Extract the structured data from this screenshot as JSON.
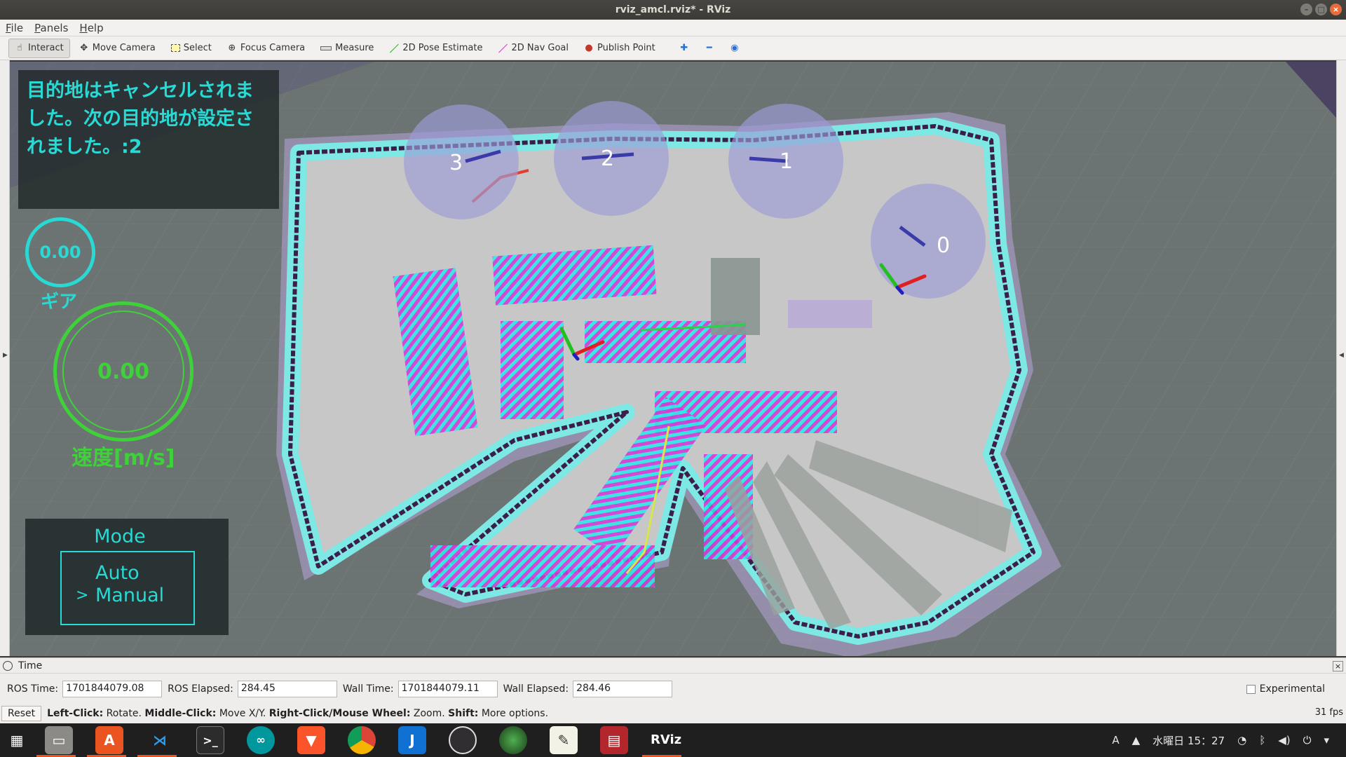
{
  "window": {
    "title": "rviz_amcl.rviz* - RViz"
  },
  "menu": {
    "items": [
      "File",
      "Panels",
      "Help"
    ]
  },
  "toolbar": {
    "tools": [
      {
        "label": "Interact",
        "icon": "hand-icon"
      },
      {
        "label": "Move Camera",
        "icon": "move-icon"
      },
      {
        "label": "Select",
        "icon": "select-box-icon"
      },
      {
        "label": "Focus Camera",
        "icon": "crosshair-icon"
      },
      {
        "label": "Measure",
        "icon": "ruler-icon"
      },
      {
        "label": "2D Pose Estimate",
        "icon": "green-arrow-icon"
      },
      {
        "label": "2D Nav Goal",
        "icon": "pink-arrow-icon"
      },
      {
        "label": "Publish Point",
        "icon": "pin-icon"
      }
    ],
    "active": "Interact"
  },
  "overlay": {
    "message": "目的地はキャンセルされました。次の目的地が設定されました。:2",
    "gear": {
      "value": "0.00",
      "label": "ギア"
    },
    "speed": {
      "value": "0.00",
      "label": "速度[m/s]"
    },
    "mode": {
      "title": "Mode",
      "auto": "Auto",
      "manual": "Manual",
      "selector": ">"
    }
  },
  "waypoints": [
    "3",
    "2",
    "1",
    "0"
  ],
  "time_panel": {
    "title": "Time",
    "ros_time_label": "ROS Time:",
    "ros_time": "1701844079.08",
    "ros_elapsed_label": "ROS Elapsed:",
    "ros_elapsed": "284.45",
    "wall_time_label": "Wall Time:",
    "wall_time": "1701844079.11",
    "wall_elapsed_label": "Wall Elapsed:",
    "wall_elapsed": "284.46",
    "experimental": "Experimental"
  },
  "status": {
    "reset": "Reset",
    "left_click": "Left-Click:",
    "left_click_desc": "Rotate.",
    "middle_click": "Middle-Click:",
    "middle_click_desc": "Move X/Y.",
    "right_click": "Right-Click/Mouse Wheel:",
    "right_click_desc": "Zoom.",
    "shift": "Shift:",
    "shift_desc": "More options.",
    "fps": "31 fps"
  },
  "taskbar": {
    "apps": [
      "apps-grid-icon",
      "files-icon",
      "software-icon",
      "vscode-icon",
      "terminal-icon",
      "arduino-icon",
      "brave-icon",
      "chrome-icon",
      "joplin-icon",
      "obs-icon",
      "camera-icon",
      "text-editor-icon",
      "slides-icon",
      "rviz-icon"
    ],
    "clock": "水曜日 15：27",
    "input": "A"
  },
  "colors": {
    "cyan": "#28d9d4",
    "green": "#3fd13a",
    "accent": "#e95420"
  }
}
